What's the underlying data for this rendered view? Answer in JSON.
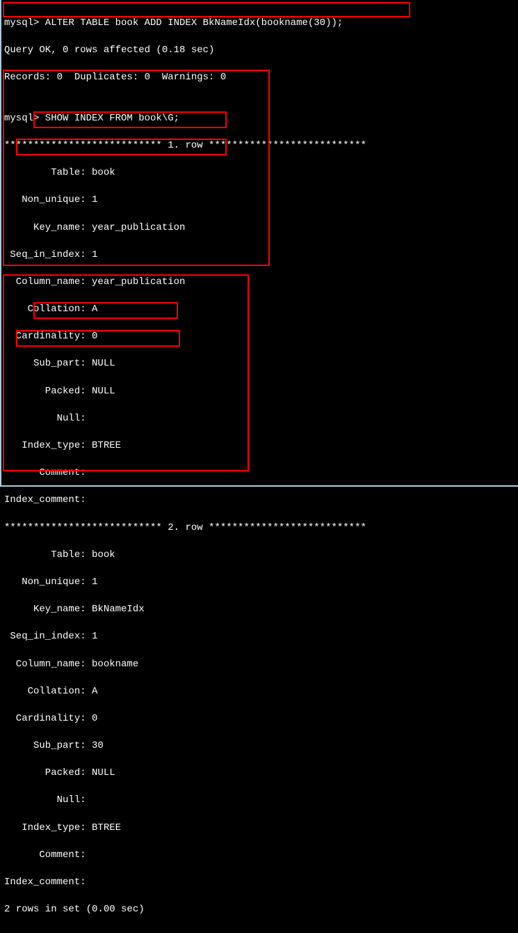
{
  "line1": "mysql> ALTER TABLE book ADD INDEX BkNameIdx(bookname(30));",
  "line2": "Query OK, 0 rows affected (0.18 sec)",
  "line3": "Records: 0  Duplicates: 0  Warnings: 0",
  "line4": "",
  "line5": "mysql> SHOW INDEX FROM book\\G;",
  "row1_header": "*************************** 1. row ***************************",
  "row1": {
    "table": "        Table: book",
    "non_unique": "   Non_unique: 1",
    "key_name": "     Key_name: year_publication",
    "seq_in_index": " Seq_in_index: 1",
    "column_name": "  Column_name: year_publication",
    "collation": "    Collation: A",
    "cardinality": "  Cardinality: 0",
    "sub_part": "     Sub_part: NULL",
    "packed": "       Packed: NULL",
    "null": "         Null:",
    "index_type": "   Index_type: BTREE",
    "comment": "      Comment:",
    "index_comment": "Index_comment:"
  },
  "row2_header": "*************************** 2. row ***************************",
  "row2": {
    "table": "        Table: book",
    "non_unique": "   Non_unique: 1",
    "key_name": "     Key_name: BkNameIdx",
    "seq_in_index": " Seq_in_index: 1",
    "column_name": "  Column_name: bookname",
    "collation": "    Collation: A",
    "cardinality": "  Cardinality: 0",
    "sub_part": "     Sub_part: 30",
    "packed": "       Packed: NULL",
    "null": "         Null:",
    "index_type": "   Index_type: BTREE",
    "comment": "      Comment:",
    "index_comment": "Index_comment:"
  },
  "footer": "2 rows in set (0.00 sec)"
}
